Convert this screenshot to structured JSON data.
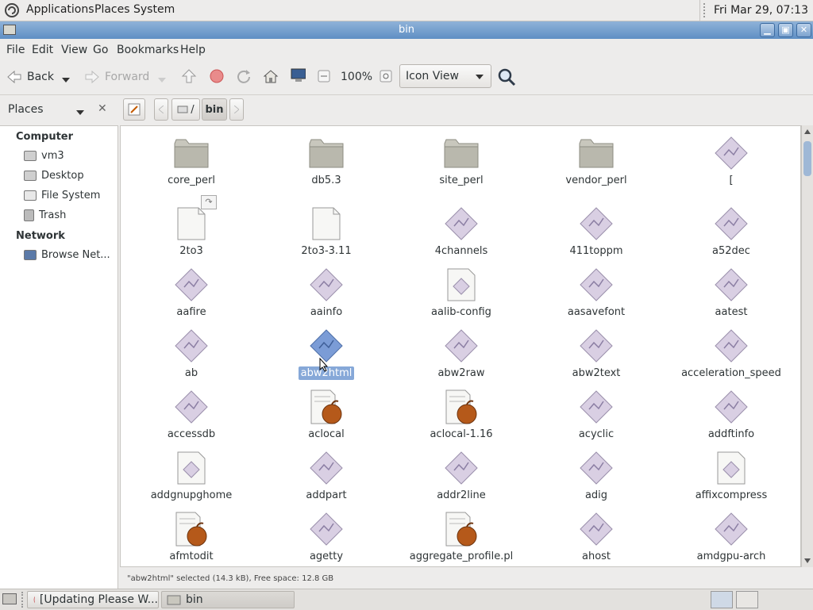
{
  "top_panel": {
    "menus": [
      "Applications",
      "Places",
      "System"
    ],
    "clock": "Fri Mar 29, 07:13"
  },
  "window": {
    "title": "bin",
    "buttons": [
      "minimize-icon",
      "maximize-icon",
      "close-icon"
    ]
  },
  "menubar": {
    "items": [
      "File",
      "Edit",
      "View",
      "Go",
      "Bookmarks",
      "Help"
    ]
  },
  "toolbar": {
    "back_label": "Back",
    "forward_label": "Forward",
    "zoom_level": "100%",
    "view_mode": "Icon View"
  },
  "location": {
    "sidebar_selector": "Places",
    "root_crumb": "/",
    "current_crumb": "bin"
  },
  "sidebar": {
    "computer_heading": "Computer",
    "computer_items": [
      "vm3",
      "Desktop",
      "File System",
      "Trash"
    ],
    "network_heading": "Network",
    "network_items": [
      "Browse Net..."
    ]
  },
  "files": [
    {
      "name": "core_perl",
      "kind": "folder"
    },
    {
      "name": "db5.3",
      "kind": "folder"
    },
    {
      "name": "site_perl",
      "kind": "folder"
    },
    {
      "name": "vendor_perl",
      "kind": "folder"
    },
    {
      "name": "[",
      "kind": "exec"
    },
    {
      "name": "2to3",
      "kind": "link"
    },
    {
      "name": "2to3-3.11",
      "kind": "doc"
    },
    {
      "name": "4channels",
      "kind": "exec"
    },
    {
      "name": "411toppm",
      "kind": "exec"
    },
    {
      "name": "a52dec",
      "kind": "exec"
    },
    {
      "name": "aafire",
      "kind": "exec"
    },
    {
      "name": "aainfo",
      "kind": "exec"
    },
    {
      "name": "aalib-config",
      "kind": "script"
    },
    {
      "name": "aasavefont",
      "kind": "exec"
    },
    {
      "name": "aatest",
      "kind": "exec"
    },
    {
      "name": "ab",
      "kind": "exec"
    },
    {
      "name": "abw2html",
      "kind": "exec",
      "selected": true
    },
    {
      "name": "abw2raw",
      "kind": "exec"
    },
    {
      "name": "abw2text",
      "kind": "exec"
    },
    {
      "name": "acceleration_speed",
      "kind": "exec"
    },
    {
      "name": "accessdb",
      "kind": "exec"
    },
    {
      "name": "aclocal",
      "kind": "perl"
    },
    {
      "name": "aclocal-1.16",
      "kind": "perl"
    },
    {
      "name": "acyclic",
      "kind": "exec"
    },
    {
      "name": "addftinfo",
      "kind": "exec"
    },
    {
      "name": "addgnupghome",
      "kind": "script"
    },
    {
      "name": "addpart",
      "kind": "exec"
    },
    {
      "name": "addr2line",
      "kind": "exec"
    },
    {
      "name": "adig",
      "kind": "exec"
    },
    {
      "name": "affixcompress",
      "kind": "script"
    },
    {
      "name": "afmtodit",
      "kind": "perl"
    },
    {
      "name": "agetty",
      "kind": "exec"
    },
    {
      "name": "aggregate_profile.pl",
      "kind": "perl"
    },
    {
      "name": "ahost",
      "kind": "exec"
    },
    {
      "name": "amdgpu-arch",
      "kind": "exec"
    }
  ],
  "status": "\"abw2html\" selected (14.3 kB), Free space: 12.8 GB",
  "taskbar": {
    "tasks": [
      "[Updating Please W...",
      "bin"
    ]
  },
  "colors": {
    "selection": "#86a8d8",
    "titlebar": "#6f9acb",
    "exec_icon": "#d9cfe3"
  }
}
